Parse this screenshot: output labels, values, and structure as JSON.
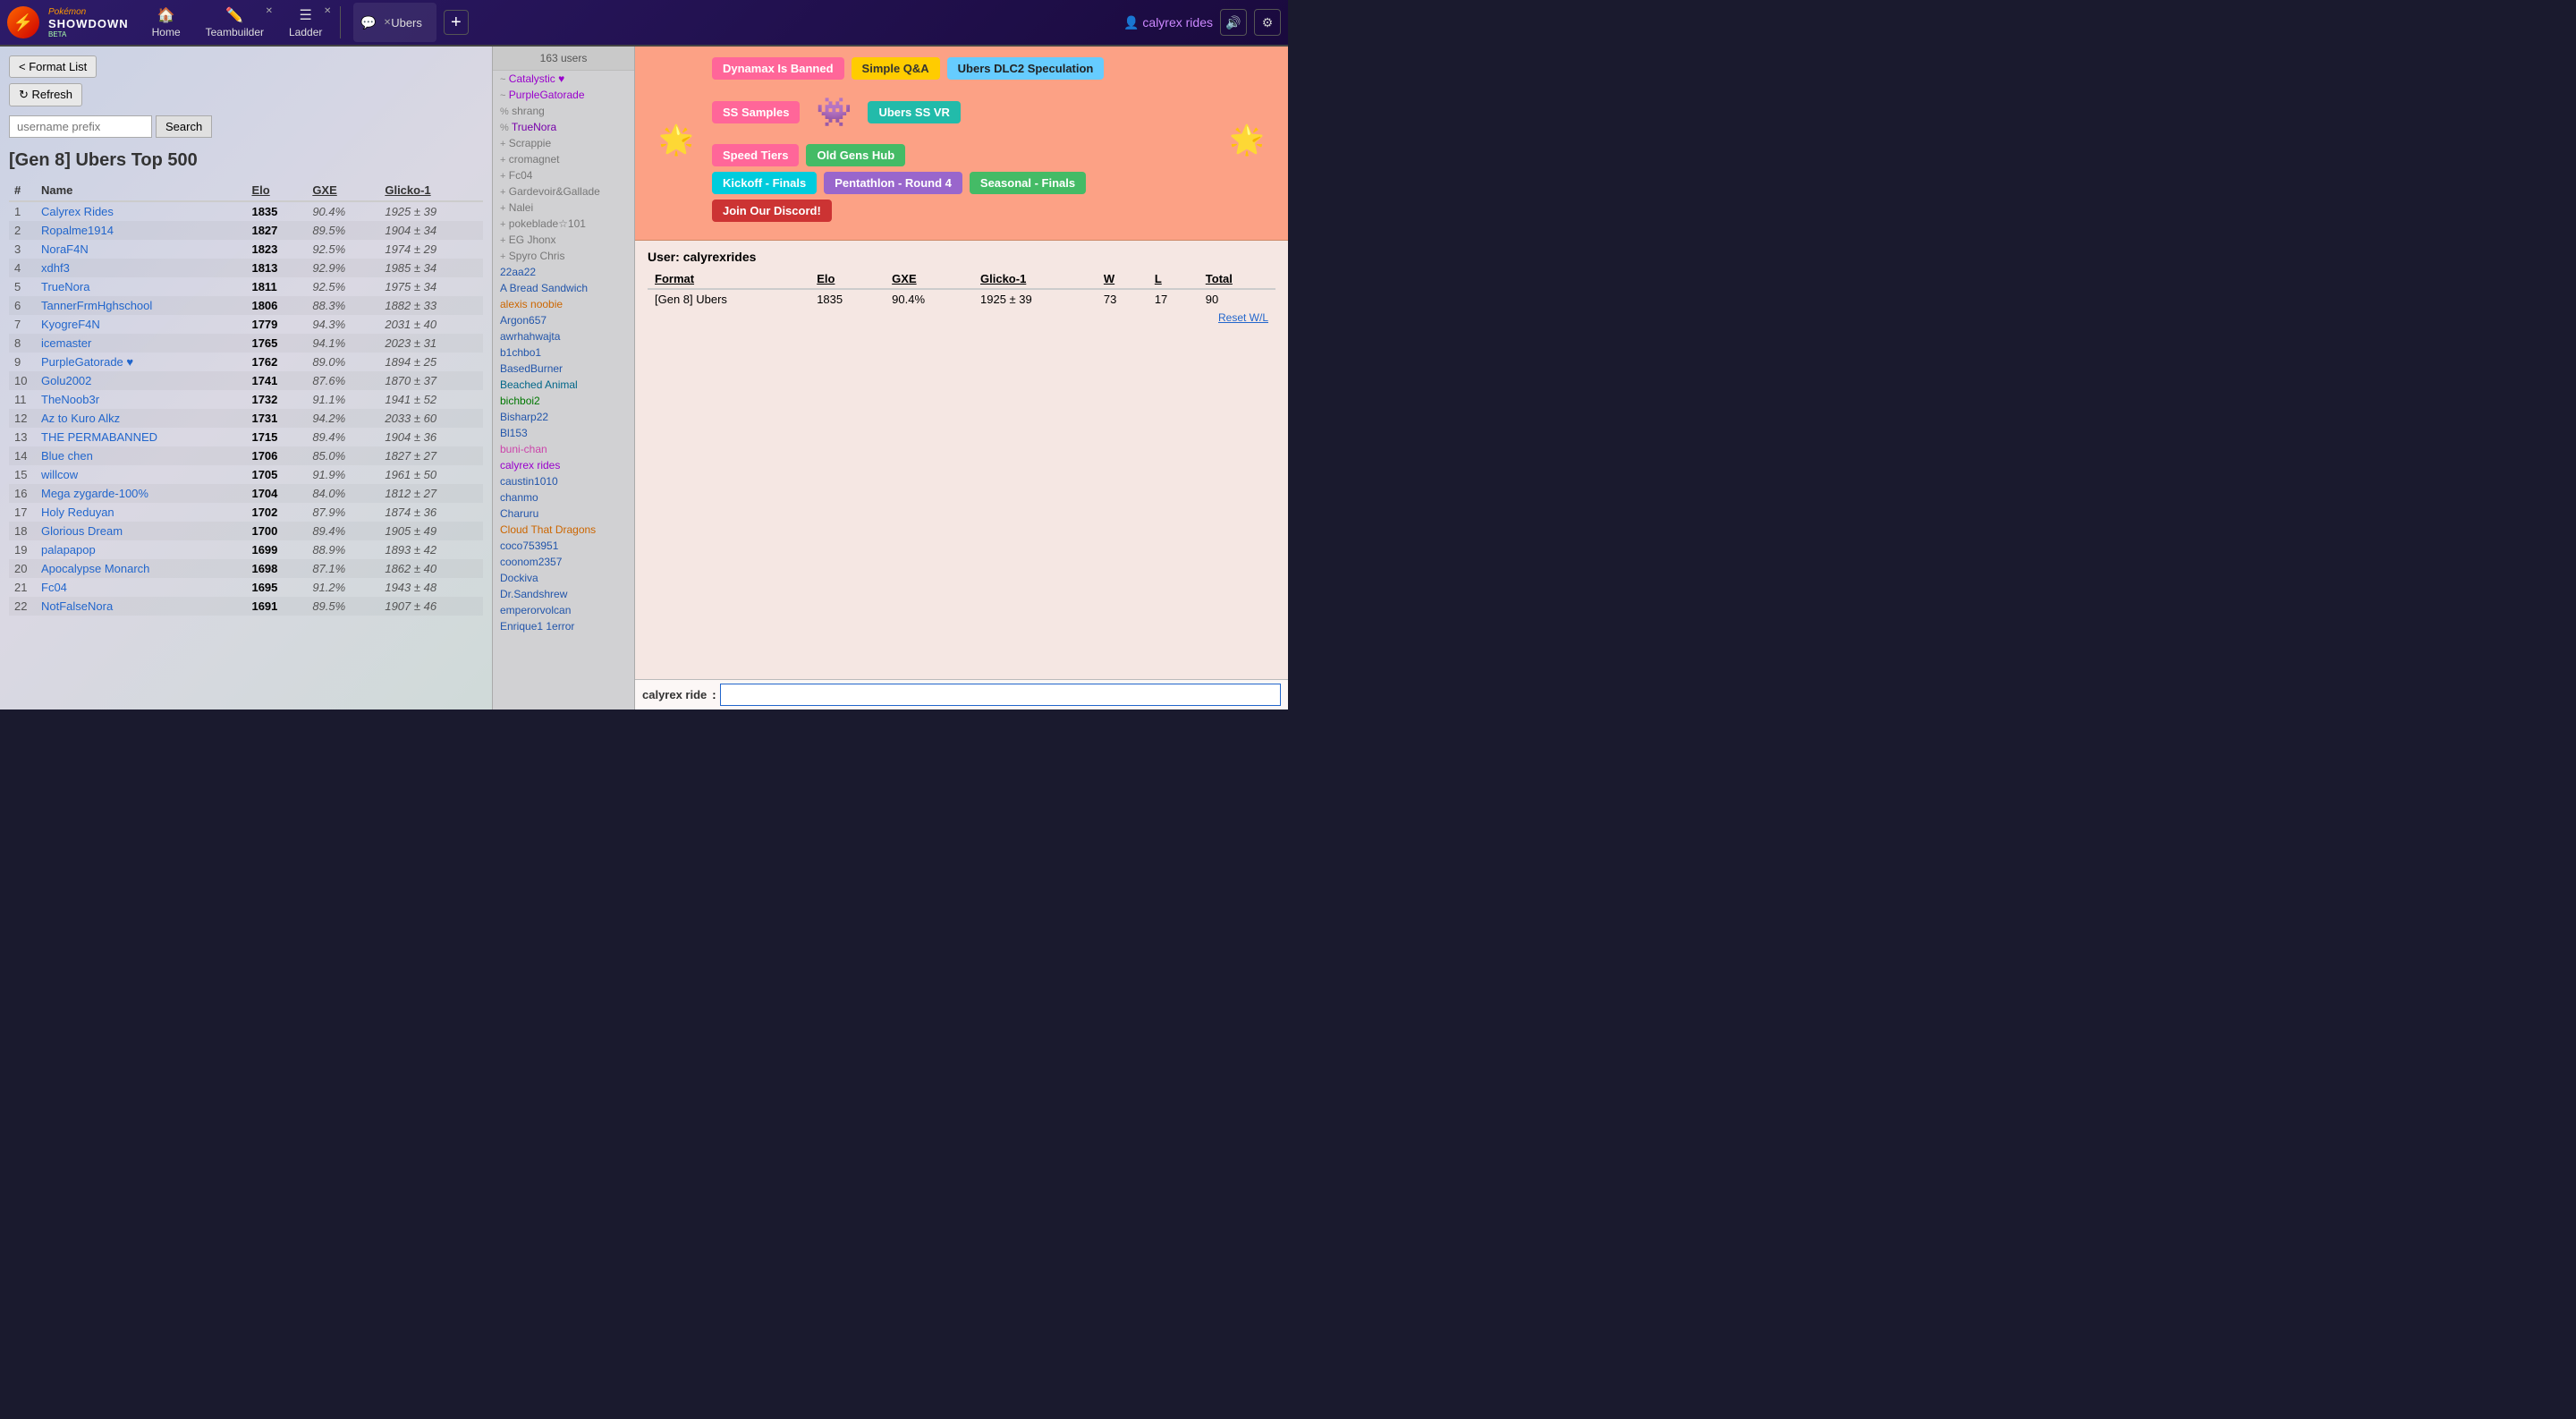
{
  "navbar": {
    "logo_line1": "Pokémon",
    "logo_line2": "SHOWDOWN",
    "logo_beta": "BETA",
    "home_label": "Home",
    "teambuilder_label": "Teambuilder",
    "ladder_label": "Ladder",
    "tab_label": "Ubers",
    "add_tab_label": "+",
    "username": "calyrex rides",
    "volume_icon": "🔊",
    "settings_icon": "⚙"
  },
  "ladder": {
    "format_list_btn": "< Format List",
    "refresh_btn": "↻ Refresh",
    "search_placeholder": "username prefix",
    "search_btn": "Search",
    "title": "[Gen 8] Ubers Top 500",
    "columns": {
      "rank": "#",
      "name": "Name",
      "elo": "Elo",
      "gxe": "GXE",
      "glicko": "Glicko-1"
    },
    "rows": [
      {
        "rank": 1,
        "name": "Calyrex Rides",
        "elo": "1835",
        "gxe": "90.4%",
        "glicko": "1925 ± 39"
      },
      {
        "rank": 2,
        "name": "Ropalme1914",
        "elo": "1827",
        "gxe": "89.5%",
        "glicko": "1904 ± 34"
      },
      {
        "rank": 3,
        "name": "NoraF4N",
        "elo": "1823",
        "gxe": "92.5%",
        "glicko": "1974 ± 29"
      },
      {
        "rank": 4,
        "name": "xdhf3",
        "elo": "1813",
        "gxe": "92.9%",
        "glicko": "1985 ± 34"
      },
      {
        "rank": 5,
        "name": "TrueNora",
        "elo": "1811",
        "gxe": "92.5%",
        "glicko": "1975 ± 34"
      },
      {
        "rank": 6,
        "name": "TannerFrmHghschool",
        "elo": "1806",
        "gxe": "88.3%",
        "glicko": "1882 ± 33"
      },
      {
        "rank": 7,
        "name": "KyogreF4N",
        "elo": "1779",
        "gxe": "94.3%",
        "glicko": "2031 ± 40"
      },
      {
        "rank": 8,
        "name": "icemaster",
        "elo": "1765",
        "gxe": "94.1%",
        "glicko": "2023 ± 31"
      },
      {
        "rank": 9,
        "name": "PurpleGatorade ♥",
        "elo": "1762",
        "gxe": "89.0%",
        "glicko": "1894 ± 25"
      },
      {
        "rank": 10,
        "name": "Golu2002",
        "elo": "1741",
        "gxe": "87.6%",
        "glicko": "1870 ± 37"
      },
      {
        "rank": 11,
        "name": "TheNoob3r",
        "elo": "1732",
        "gxe": "91.1%",
        "glicko": "1941 ± 52"
      },
      {
        "rank": 12,
        "name": "Az to Kuro Alkz",
        "elo": "1731",
        "gxe": "94.2%",
        "glicko": "2033 ± 60"
      },
      {
        "rank": 13,
        "name": "THE PERMABANNED",
        "elo": "1715",
        "gxe": "89.4%",
        "glicko": "1904 ± 36"
      },
      {
        "rank": 14,
        "name": "Blue chen",
        "elo": "1706",
        "gxe": "85.0%",
        "glicko": "1827 ± 27"
      },
      {
        "rank": 15,
        "name": "willcow",
        "elo": "1705",
        "gxe": "91.9%",
        "glicko": "1961 ± 50"
      },
      {
        "rank": 16,
        "name": "Mega zygarde-100%",
        "elo": "1704",
        "gxe": "84.0%",
        "glicko": "1812 ± 27"
      },
      {
        "rank": 17,
        "name": "Holy Reduyan",
        "elo": "1702",
        "gxe": "87.9%",
        "glicko": "1874 ± 36"
      },
      {
        "rank": 18,
        "name": "Glorious Dream",
        "elo": "1700",
        "gxe": "89.4%",
        "glicko": "1905 ± 49"
      },
      {
        "rank": 19,
        "name": "palapapop",
        "elo": "1699",
        "gxe": "88.9%",
        "glicko": "1893 ± 42"
      },
      {
        "rank": 20,
        "name": "Apocalypse Monarch",
        "elo": "1698",
        "gxe": "87.1%",
        "glicko": "1862 ± 40"
      },
      {
        "rank": 21,
        "name": "Fc04",
        "elo": "1695",
        "gxe": "91.2%",
        "glicko": "1943 ± 48"
      },
      {
        "rank": 22,
        "name": "NotFalseNora",
        "elo": "1691",
        "gxe": "89.5%",
        "glicko": "1907 ± 46"
      }
    ]
  },
  "users_panel": {
    "count": "163 users",
    "users": [
      {
        "name": "Catalystic ♥",
        "color": "purple",
        "rank": "~"
      },
      {
        "name": "PurpleGatorade",
        "color": "purple",
        "rank": "~"
      },
      {
        "name": "shrang",
        "color": "gray",
        "rank": "%"
      },
      {
        "name": "TrueNora",
        "color": "purple2",
        "rank": "%"
      },
      {
        "name": "Scrappie",
        "color": "gray",
        "rank": "+"
      },
      {
        "name": "cromagnet",
        "color": "gray",
        "rank": "+"
      },
      {
        "name": "Fc04",
        "color": "gray",
        "rank": "+"
      },
      {
        "name": "Gardevoir&Gallade",
        "color": "gray",
        "rank": "+"
      },
      {
        "name": "Nalei",
        "color": "gray",
        "rank": "+"
      },
      {
        "name": "pokeblade☆101",
        "color": "gray",
        "rank": "+"
      },
      {
        "name": "EG Jhonx",
        "color": "gray",
        "rank": "+"
      },
      {
        "name": "Spyro Chris",
        "color": "gray",
        "rank": "+"
      },
      {
        "name": "22aa22",
        "color": "blue",
        "rank": ""
      },
      {
        "name": "A Bread Sandwich",
        "color": "blue",
        "rank": ""
      },
      {
        "name": "alexis noobie",
        "color": "orange",
        "rank": ""
      },
      {
        "name": "Argon657",
        "color": "blue",
        "rank": ""
      },
      {
        "name": "awrhahwajta",
        "color": "blue",
        "rank": ""
      },
      {
        "name": "b1chbo1",
        "color": "blue",
        "rank": ""
      },
      {
        "name": "BasedBurner",
        "color": "blue",
        "rank": ""
      },
      {
        "name": "Beached Animal",
        "color": "teal",
        "rank": ""
      },
      {
        "name": "bichboi2",
        "color": "green",
        "rank": ""
      },
      {
        "name": "Bisharp22",
        "color": "blue",
        "rank": ""
      },
      {
        "name": "Bl153",
        "color": "blue",
        "rank": ""
      },
      {
        "name": "buni-chan",
        "color": "pink",
        "rank": ""
      },
      {
        "name": "calyrex rides",
        "color": "purple",
        "rank": ""
      },
      {
        "name": "caustin1010",
        "color": "blue",
        "rank": ""
      },
      {
        "name": "chanmo",
        "color": "blue",
        "rank": ""
      },
      {
        "name": "Charuru",
        "color": "blue",
        "rank": ""
      },
      {
        "name": "Cloud That Dragons",
        "color": "orange",
        "rank": ""
      },
      {
        "name": "coco753951",
        "color": "blue",
        "rank": ""
      },
      {
        "name": "coonom2357",
        "color": "blue",
        "rank": ""
      },
      {
        "name": "Dockiva",
        "color": "blue",
        "rank": ""
      },
      {
        "name": "Dr.Sandshrew",
        "color": "blue",
        "rank": ""
      },
      {
        "name": "emperorvolcan",
        "color": "blue",
        "rank": ""
      },
      {
        "name": "Enrique1 1error",
        "color": "blue",
        "rank": ""
      }
    ]
  },
  "room": {
    "name": "Ubers",
    "banners": {
      "dynamax": "Dynamax Is Banned",
      "simple_qa": "Simple Q&A",
      "ubers_dlc2": "Ubers DLC2 Speculation",
      "ss_samples": "SS Samples",
      "ubers_ss_vr": "Ubers SS VR",
      "speed_tiers": "Speed Tiers",
      "old_gens": "Old Gens Hub",
      "kickoff": "Kickoff - Finals",
      "pentathlon": "Pentathlon - Round 4",
      "seasonal": "Seasonal - Finals",
      "discord": "Join Our Discord!"
    },
    "user_stats": {
      "label": "User:",
      "username": "calyrexrides",
      "format_header": "Format",
      "elo_header": "Elo",
      "gxe_header": "GXE",
      "glicko_header": "Glicko-1",
      "w_header": "W",
      "l_header": "L",
      "total_header": "Total",
      "format_value": "[Gen 8] Ubers",
      "elo_value": "1835",
      "gxe_value": "90.4%",
      "glicko_value": "1925 ± 39",
      "w_value": "73",
      "l_value": "17",
      "total_value": "90",
      "reset_link": "Reset W/L"
    },
    "chat_name": "calyrex ride",
    "chat_placeholder": ""
  }
}
